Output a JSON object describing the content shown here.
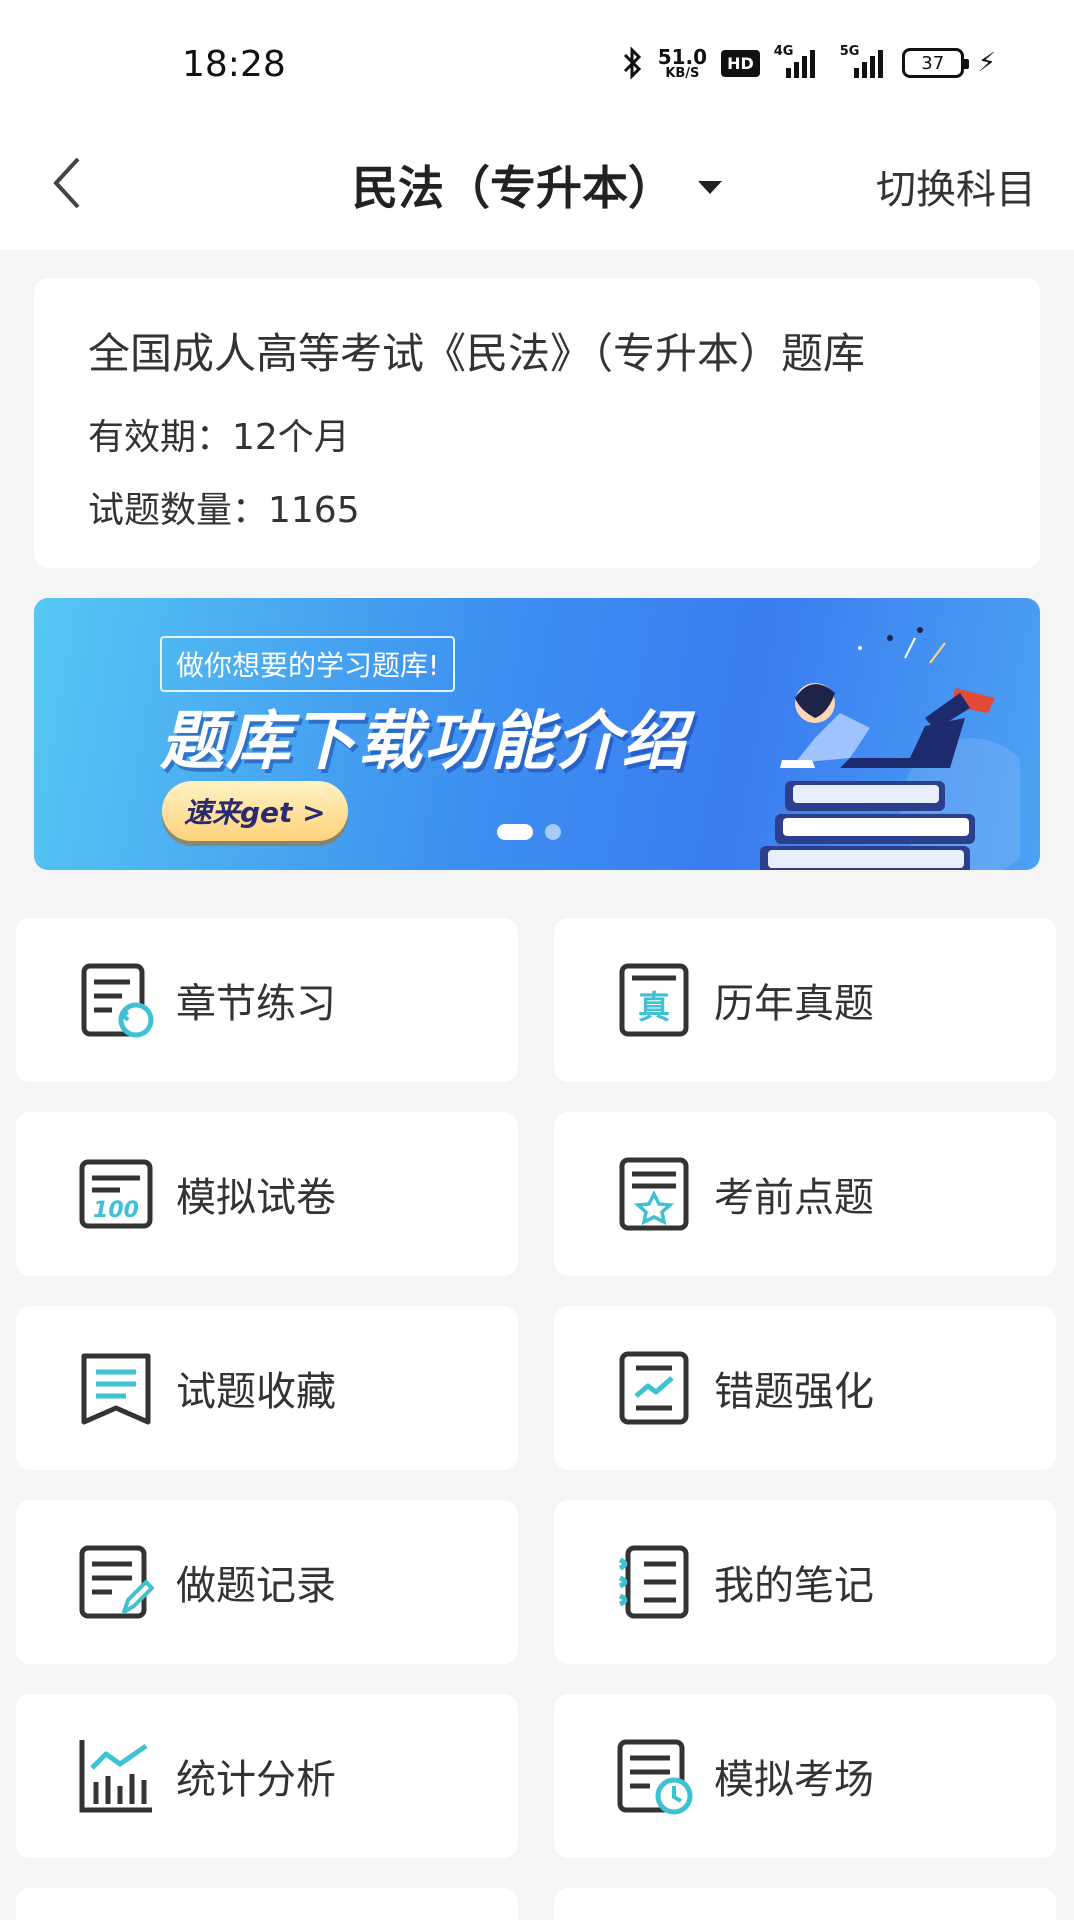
{
  "status_bar": {
    "time": "18:28",
    "net_speed_value": "51.0",
    "net_speed_unit": "KB/S",
    "hd_badge": "HD",
    "signal1_label": "4G",
    "signal2_label": "5G",
    "battery": "37"
  },
  "nav": {
    "title": "民法（专升本）",
    "switch_subject": "切换科目"
  },
  "info_card": {
    "title": "全国成人高等考试《民法》（专升本）题库",
    "validity": "有效期：12个月",
    "question_count": "试题数量：1165"
  },
  "banner": {
    "subtitle": "做你想要的学习题库!",
    "title": "题库下载功能介绍",
    "cta": "速来get >",
    "slide_count": 2,
    "active_slide": 1
  },
  "colors": {
    "accent": "#3ec1d3",
    "icon_stroke": "#333333",
    "page_bg": "#f5f5f5"
  },
  "menu": {
    "chapter_practice": {
      "label": "章节练习",
      "icon": "chapter-practice-icon"
    },
    "past_exams": {
      "label": "历年真题",
      "icon": "past-exams-icon"
    },
    "mock_paper": {
      "label": "模拟试卷",
      "icon": "mock-paper-icon"
    },
    "pre_exam_tips": {
      "label": "考前点题",
      "icon": "pre-exam-tips-icon"
    },
    "favorites": {
      "label": "试题收藏",
      "icon": "favorites-icon"
    },
    "wrong_questions": {
      "label": "错题强化",
      "icon": "wrong-questions-icon"
    },
    "history": {
      "label": "做题记录",
      "icon": "history-icon"
    },
    "notes": {
      "label": "我的笔记",
      "icon": "notes-icon"
    },
    "statistics": {
      "label": "统计分析",
      "icon": "statistics-icon"
    },
    "mock_exam_room": {
      "label": "模拟考场",
      "icon": "mock-exam-room-icon"
    }
  }
}
